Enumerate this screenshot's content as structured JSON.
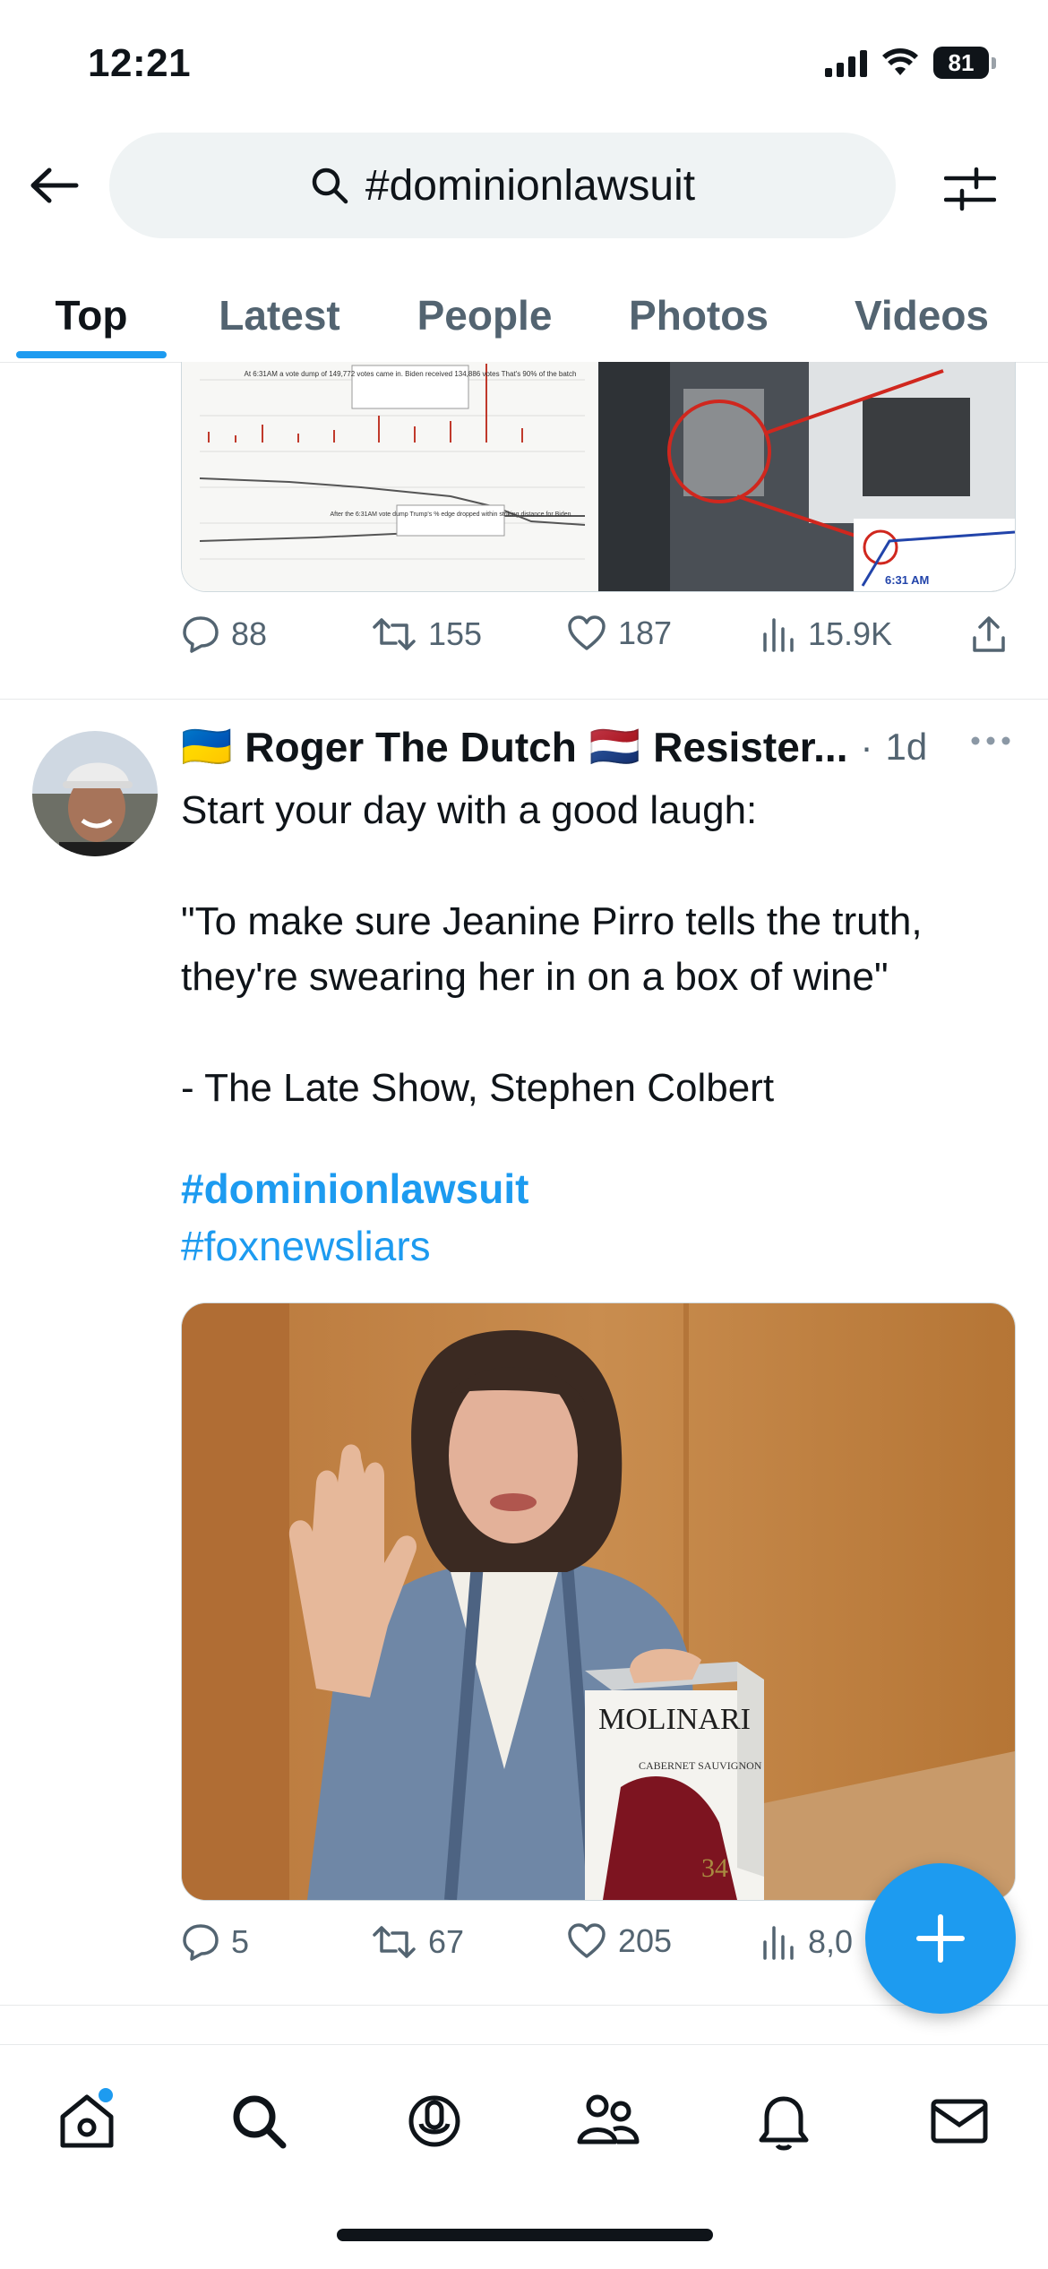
{
  "status_bar": {
    "time": "12:21",
    "battery": "81"
  },
  "header": {
    "search_query": "#dominionlawsuit"
  },
  "tabs": [
    {
      "label": "Top",
      "active": true
    },
    {
      "label": "Latest",
      "active": false
    },
    {
      "label": "People",
      "active": false
    },
    {
      "label": "Photos",
      "active": false
    },
    {
      "label": "Videos",
      "active": false
    }
  ],
  "previous_post": {
    "chart_caption_1": "At 6:31AM a vote dump of 149,772 votes came in. Biden received 134,886 votes That's 90% of the batch",
    "chart_caption_2": "After the 6:31AM vote dump Trump's % edge dropped within striking distance for Biden",
    "photo_timestamp": "6:31 AM",
    "replies": "88",
    "reposts": "155",
    "likes": "187",
    "views": "15.9K"
  },
  "post": {
    "flag_left": "🇺🇦",
    "author": "Roger The Dutch",
    "flag_right": "🇳🇱",
    "author_suffix": "Resister...",
    "separator": "·",
    "time": "1d",
    "text": "Start your day with a good laugh:\n\n\"To make sure Jeanine Pirro tells the truth, they're swearing her in on a box of wine\"\n\n- The Late Show, Stephen Colbert",
    "hashtag_1": "#dominionlawsuit",
    "hashtag_2": "#foxnewsliars",
    "image_box_brand": "MOLINARI",
    "image_box_wine": "CABERNET SAUVIGNON",
    "image_box_number": "34",
    "replies": "5",
    "reposts": "67",
    "likes": "205",
    "views": "8,0"
  },
  "colors": {
    "accent": "#1d9bf0",
    "text": "#0f1419",
    "muted": "#536471"
  }
}
